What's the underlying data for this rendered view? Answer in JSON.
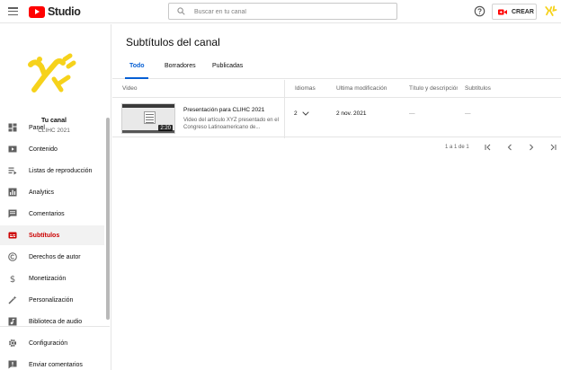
{
  "app": {
    "logo_text": "Studio",
    "search_placeholder": "Buscar en tu canal",
    "create_label": "CREAR"
  },
  "channel": {
    "title": "Tu canal",
    "subtitle": "CLIHC 2021"
  },
  "sidebar": {
    "items": [
      {
        "label": "Panel",
        "icon": "dashboard-icon"
      },
      {
        "label": "Contenido",
        "icon": "content-icon"
      },
      {
        "label": "Listas de reproducción",
        "icon": "playlist-icon"
      },
      {
        "label": "Analytics",
        "icon": "analytics-icon"
      },
      {
        "label": "Comentarios",
        "icon": "comments-icon"
      },
      {
        "label": "Subtítulos",
        "icon": "subtitles-icon",
        "active": true
      },
      {
        "label": "Derechos de autor",
        "icon": "copyright-icon"
      },
      {
        "label": "Monetización",
        "icon": "dollar-icon"
      },
      {
        "label": "Personalización",
        "icon": "magic-wand-icon"
      },
      {
        "label": "Biblioteca de audio",
        "icon": "audio-library-icon"
      },
      {
        "label": "Configuración",
        "icon": "gear-icon"
      },
      {
        "label": "Enviar comentarios",
        "icon": "feedback-icon"
      }
    ]
  },
  "page": {
    "title": "Subtítulos del canal",
    "tabs": [
      {
        "label": "Todo",
        "active": true
      },
      {
        "label": "Borradores",
        "active": false
      },
      {
        "label": "Publicadas",
        "active": false
      }
    ]
  },
  "table": {
    "headers": {
      "video": "Video",
      "languages": "Idiomas",
      "modified": "Última modificación",
      "title_desc": "Título y descripción",
      "subtitles": "Subtítulos"
    },
    "rows": [
      {
        "duration": "2:20",
        "title": "Presentación para CLIHC 2021",
        "description": "Video del artículo XYZ presentado en el Congreso Latinoamericano de...",
        "languages": "2",
        "modified": "2 nov. 2021",
        "title_desc": "—",
        "subtitles": "—"
      }
    ]
  },
  "pagination": {
    "info": "1 a 1 de 1"
  },
  "colors": {
    "brand_red": "#ff0000",
    "active_red": "#cc0000",
    "tab_blue": "#065fd4",
    "logo_yellow": "#f6d21b"
  }
}
